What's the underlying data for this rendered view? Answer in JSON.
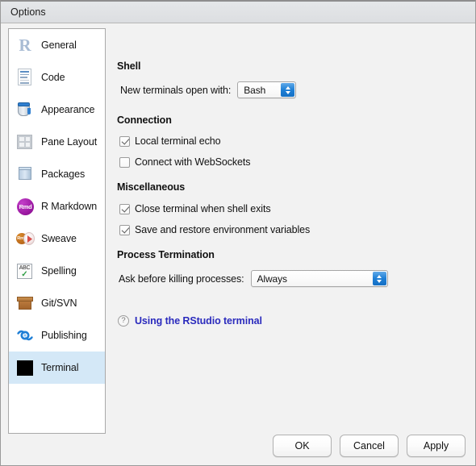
{
  "window": {
    "title": "Options"
  },
  "sidebar": {
    "items": [
      {
        "label": "General",
        "icon": "r-logo-icon",
        "selected": false
      },
      {
        "label": "Code",
        "icon": "code-document-icon",
        "selected": false
      },
      {
        "label": "Appearance",
        "icon": "paint-bucket-icon",
        "selected": false
      },
      {
        "label": "Pane Layout",
        "icon": "pane-grid-icon",
        "selected": false
      },
      {
        "label": "Packages",
        "icon": "package-box-icon",
        "selected": false
      },
      {
        "label": "R Markdown",
        "icon": "rmd-circle-icon",
        "selected": false
      },
      {
        "label": "Sweave",
        "icon": "sweave-pdf-icon",
        "selected": false
      },
      {
        "label": "Spelling",
        "icon": "spellcheck-icon",
        "selected": false
      },
      {
        "label": "Git/SVN",
        "icon": "git-box-icon",
        "selected": false
      },
      {
        "label": "Publishing",
        "icon": "publish-sync-icon",
        "selected": false
      },
      {
        "label": "Terminal",
        "icon": "terminal-black-icon",
        "selected": true
      }
    ]
  },
  "main": {
    "shell": {
      "heading": "Shell",
      "new_terminals_label": "New terminals open with:",
      "new_terminals_value": "Bash"
    },
    "connection": {
      "heading": "Connection",
      "options": [
        {
          "label": "Local terminal echo",
          "checked": true
        },
        {
          "label": "Connect with WebSockets",
          "checked": false
        }
      ]
    },
    "miscellaneous": {
      "heading": "Miscellaneous",
      "options": [
        {
          "label": "Close terminal when shell exits",
          "checked": true
        },
        {
          "label": "Save and restore environment variables",
          "checked": true
        }
      ]
    },
    "process_termination": {
      "heading": "Process Termination",
      "ask_label": "Ask before killing processes:",
      "ask_value": "Always"
    },
    "help": {
      "icon": "question-mark-icon",
      "link_text": "Using the RStudio terminal"
    }
  },
  "footer": {
    "ok_label": "OK",
    "cancel_label": "Cancel",
    "apply_label": "Apply"
  },
  "colors": {
    "selection_blue": "#d4e8f7",
    "link_blue": "#2b2bbd",
    "stepper_blue": "#1f7fd6",
    "window_background": "#f2f2f2",
    "titlebar": "#dcdee1"
  },
  "icon_glyphs": {
    "r_logo": "R",
    "rmd": "Rmd",
    "sweave_circle": "Rnw",
    "spelling_abc": "ABC",
    "spelling_check": "✓",
    "question": "?"
  }
}
